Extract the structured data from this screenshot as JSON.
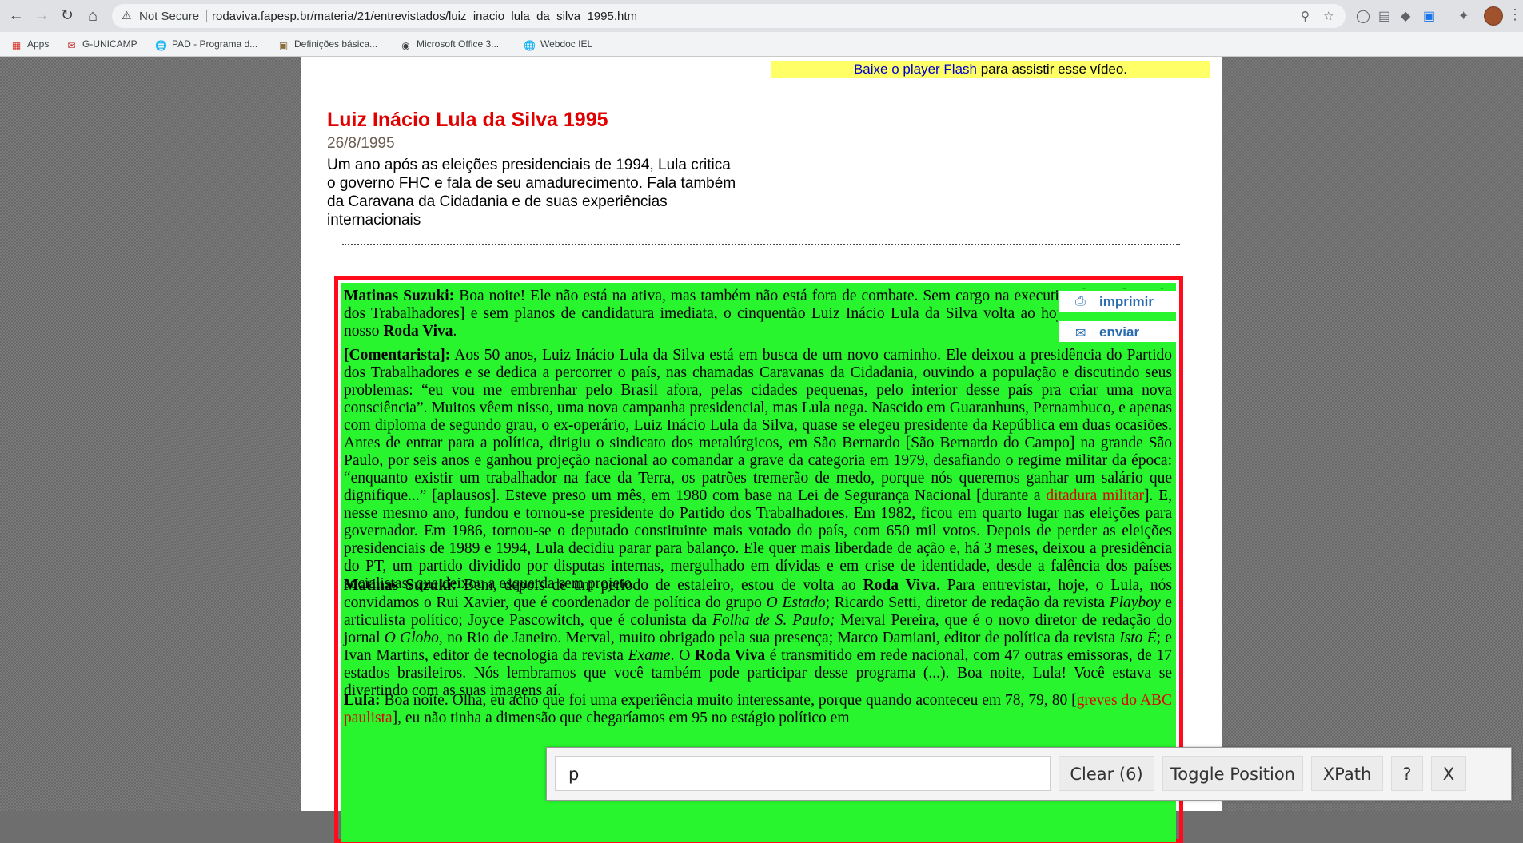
{
  "browser": {
    "security_label": "Not Secure",
    "url": "rodaviva.fapesp.br/materia/21/entrevistados/luiz_inacio_lula_da_silva_1995.htm",
    "bookmarks": [
      "Apps",
      "G-UNICAMP",
      "PAD - Programa d...",
      "Definições básica...",
      "Microsoft Office 3...",
      "Webdoc IEL"
    ]
  },
  "page": {
    "flash_link": "Baixe o player Flash",
    "flash_text": " para assistir esse vídeo.",
    "title": "Luiz Inácio Lula da Silva 1995",
    "date": "26/8/1995",
    "summary": "Um ano após as eleições presidenciais de 1994, Lula critica o governo FHC e fala de seu amadurecimento. Fala também da Caravana da Cidadania e de suas experiências internacionais",
    "actions": {
      "print": "imprimir",
      "send": "enviar"
    },
    "transcript": {
      "p1": {
        "speaker": "Matinas Suzuki:",
        "text": " Boa noite! Ele não está na ativa, mas também não está fora de combate. Sem cargo na executiva do PT [Partido dos Trabalhadores] e sem planos de candidatura imediata, o cinquentão Luiz Inácio Lula da Silva volta ao hoje ao palanque do nosso ",
        "bold": "Roda Viva",
        "end": "."
      },
      "p2": {
        "speaker": "[Comentarista]:",
        "text_a": " Aos 50 anos, Luiz Inácio Lula da Silva está em busca de um novo caminho. Ele deixou a presidência do Partido dos Trabalhadores e se dedica a percorrer o país, nas chamadas Caravanas da Cidadania, ouvindo a população e discutindo seus problemas: “eu vou me embrenhar pelo Brasil afora, pelas cidades pequenas, pelo interior desse país pra criar uma nova consciência”. Muitos vêem nisso, uma nova campanha presidencial, mas Lula nega. Nascido em Guaranhuns, Pernambuco, e apenas com diploma de segundo grau, o ex-operário, Luiz Inácio Lula da Silva, quase se elegeu presidente da República em duas ocasiões. Antes de entrar para a política, dirigiu o sindicato dos metalúrgicos, em São Bernardo [São Bernardo do Campo] na grande São Paulo, por seis anos e ganhou projeção nacional ao comandar a grave da categoria em 1979, desafiando o regime militar da época: “enquanto existir um trabalhador na face da Terra, os patrões tremerão de medo, porque nós queremos ganhar um salário que dignifique...” [aplausos]. Esteve preso um mês, em 1980 com base na Lei de Segurança Nacional [durante a ",
        "link": "ditadura militar",
        "text_b": "]. E, nesse mesmo ano, fundou e tornou-se presidente do Partido dos Trabalhadores. Em 1982, ficou em quarto lugar nas eleições para governador. Em 1986, tornou-se o deputado constituinte mais votado do país, com 650 mil votos. Depois de perder as eleições presidenciais de 1989 e 1994, Lula decidiu parar para balanço. Ele quer mais liberdade de ação e, há 3 meses, deixou a presidência do PT, um partido dividido por disputas internas, mergulhado em dívidas e em crise de identidade, desde a falência dos países socialistas, que deixou a esquerda sem projeto."
      },
      "p3": {
        "speaker": "Matinas Suzuki:",
        "t1": " Bem, depois de um período de estaleiro, estou de volta ao ",
        "b1": "Roda Viva",
        "t2": ". Para entrevistar, hoje, o Lula, nós convidamos o Rui Xavier, que é coordenador de política do grupo ",
        "i1": "O Estado",
        "t3": "; Ricardo Setti, diretor de redação da revista ",
        "i2": "Playboy",
        "t4": " e articulista político; Joyce Pascowitch, que é colunista da ",
        "i3": "Folha de S. Paulo;",
        "t5": " Merval Pereira, que é o novo diretor de redação do jornal ",
        "i4": "O Globo",
        "t6": ", no Rio de Janeiro. Merval, muito obrigado pela sua presença; Marco Damiani, editor de política da revista ",
        "i5": "Isto É",
        "t7": "; e Ivan Martins, editor de tecnologia da revista ",
        "i6": "Exame",
        "t8": ". O ",
        "b2": "Roda Viva",
        "t9": " é transmitido em rede nacional, com 47 outras emissoras, de 17 estados brasileiros. Nós lembramos que você também pode participar desse programa (...). Boa noite, Lula! Você estava se divertindo com as suas imagens aí."
      },
      "p4": {
        "speaker": "Lula:",
        "t1": " Boa noite. Olha, eu acho que foi uma experiência muito interessante, porque quando aconteceu em 78, 79, 80 [",
        "link": "greves do ABC paulista",
        "t2": "], eu não tinha a dimensão que chegaríamos em 95 no estágio político em"
      }
    }
  },
  "findbar": {
    "query": "p",
    "clear_label": "Clear (6)",
    "toggle_label": "Toggle Position",
    "xpath_label": "XPath",
    "help_label": "?",
    "close_label": "X"
  }
}
